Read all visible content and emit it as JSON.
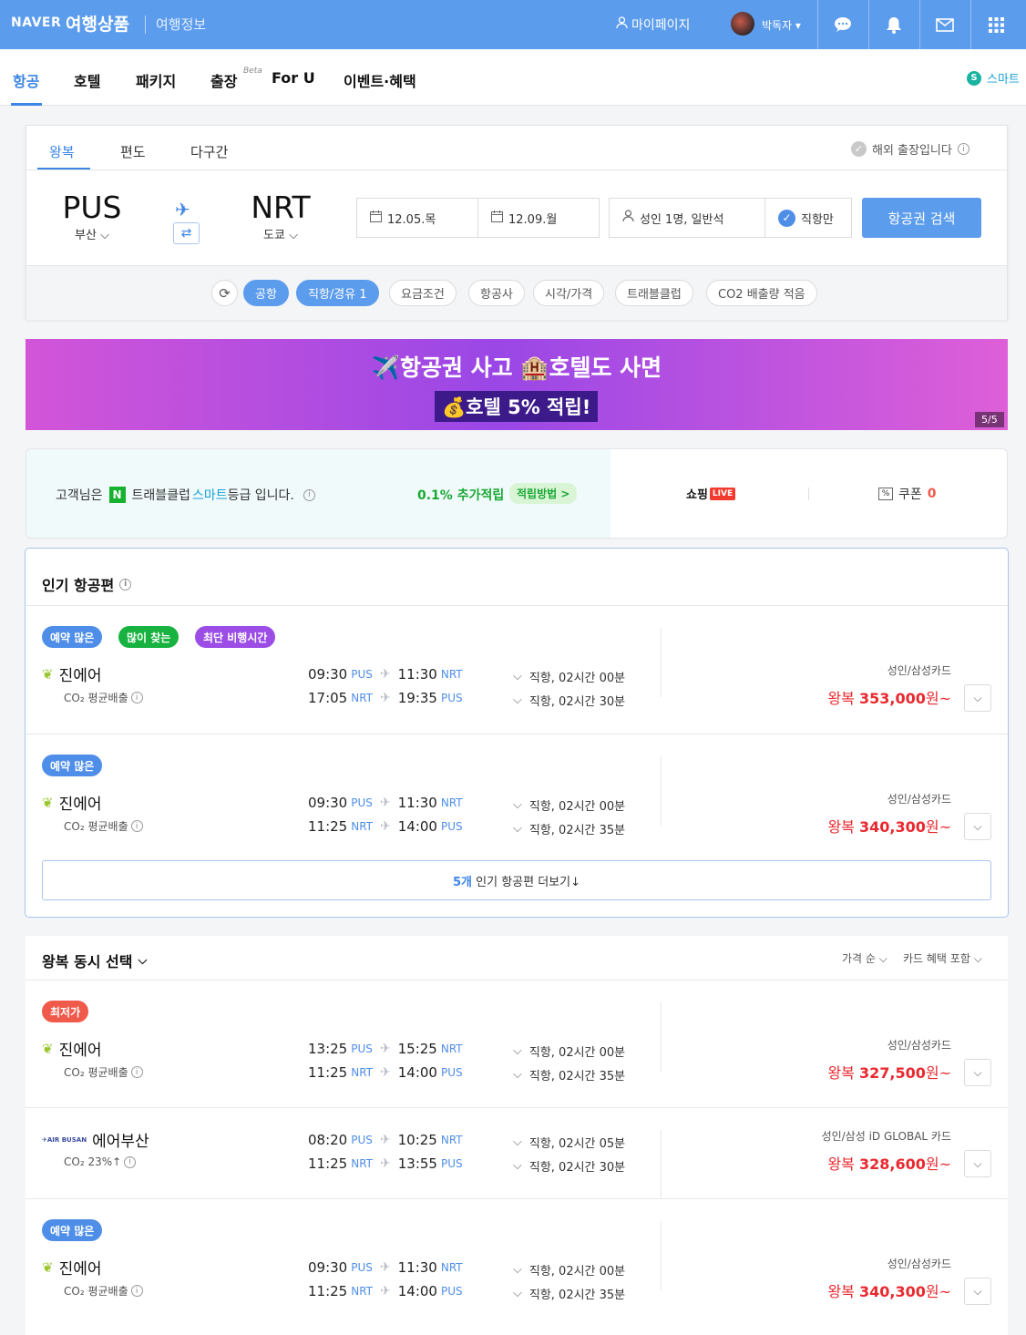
{
  "topbar": {
    "logo": "NAVER",
    "brand": "여행상품",
    "info": "여행정보",
    "mypage": "마이페이지",
    "user": "박독자 ▾",
    "icons": [
      "chat-icon",
      "bell-icon",
      "mail-icon",
      "apps-grid-icon"
    ]
  },
  "nav": {
    "tabs": [
      "항공",
      "호텔",
      "패키지",
      "출장",
      "For U",
      "이벤트·혜택"
    ],
    "beta": "Beta",
    "smart_badge": "S",
    "smart": "스마트"
  },
  "search": {
    "tabs": [
      "왕복",
      "편도",
      "다구간"
    ],
    "overseas": "해외 출장입니다",
    "origin_code": "PUS",
    "origin_city": "부산",
    "dest_code": "NRT",
    "dest_city": "도쿄",
    "date_from": "12.05.목",
    "date_to": "12.09.월",
    "passengers": "성인 1명, 일반석",
    "direct_only": "직항만",
    "search_button": "항공권 검색",
    "filters": [
      "공항",
      "직항/경유 1",
      "요금조건",
      "항공사",
      "시각/가격",
      "트래블클럽",
      "CO2 배출량 적음"
    ]
  },
  "banner": {
    "line1": "✈️항공권 사고 🏨호텔도 사면",
    "line2": "💰호텔 5% 적립!",
    "pager": "5/5"
  },
  "club": {
    "msg_prefix": "고객님은",
    "n_logo": "N",
    "club_name": "트래블클럽",
    "grade": "스마트",
    "msg_suffix": "등급 입니다.",
    "accrue": "0.1% 추가적립",
    "howto": "적립방법 >",
    "shopping": "쇼핑",
    "live": "LIVE",
    "coupon_label": "쿠폰",
    "coupon_count": "0"
  },
  "popular": {
    "title": "인기 항공편",
    "more_count": "5개",
    "more_text": "인기 항공편 더보기↓",
    "flights": [
      {
        "badges": [
          {
            "text": "예약 많은",
            "color": "blue"
          },
          {
            "text": "많이 찾는",
            "color": "green"
          },
          {
            "text": "최단 비행시간",
            "color": "purple"
          }
        ],
        "airline": "진에어",
        "co2": "CO₂ 평균배출",
        "out": {
          "dep": "09:30",
          "dep_ap": "PUS",
          "arr": "11:30",
          "arr_ap": "NRT",
          "dur": "직항, 02시간 00분"
        },
        "ret": {
          "dep": "17:05",
          "dep_ap": "NRT",
          "arr": "19:35",
          "arr_ap": "PUS",
          "dur": "직항, 02시간 30분"
        },
        "card": "성인/삼성카드",
        "price_prefix": "왕복",
        "price": "353,000",
        "price_suffix": "원~"
      },
      {
        "badges": [
          {
            "text": "예약 많은",
            "color": "blue"
          }
        ],
        "airline": "진에어",
        "co2": "CO₂ 평균배출",
        "out": {
          "dep": "09:30",
          "dep_ap": "PUS",
          "arr": "11:30",
          "arr_ap": "NRT",
          "dur": "직항, 02시간 00분"
        },
        "ret": {
          "dep": "11:25",
          "dep_ap": "NRT",
          "arr": "14:00",
          "arr_ap": "PUS",
          "dur": "직항, 02시간 35분"
        },
        "card": "성인/삼성카드",
        "price_prefix": "왕복",
        "price": "340,300",
        "price_suffix": "원~"
      }
    ]
  },
  "roundtrip": {
    "title": "왕복 동시 선택",
    "sort_price": "가격 순",
    "sort_card": "카드 혜택 포함",
    "flights": [
      {
        "badges": [
          {
            "text": "최저가",
            "color": "red"
          }
        ],
        "airline": "진에어",
        "co2": "CO₂ 평균배출",
        "out": {
          "dep": "13:25",
          "dep_ap": "PUS",
          "arr": "15:25",
          "arr_ap": "NRT",
          "dur": "직항, 02시간 00분"
        },
        "ret": {
          "dep": "11:25",
          "dep_ap": "NRT",
          "arr": "14:00",
          "arr_ap": "PUS",
          "dur": "직항, 02시간 35분"
        },
        "card": "성인/삼성카드",
        "price_prefix": "왕복",
        "price": "327,500",
        "price_suffix": "원~"
      },
      {
        "badges": [],
        "airline": "에어부산",
        "co2": "CO₂ 23%↑",
        "out": {
          "dep": "08:20",
          "dep_ap": "PUS",
          "arr": "10:25",
          "arr_ap": "NRT",
          "dur": "직항, 02시간 05분"
        },
        "ret": {
          "dep": "11:25",
          "dep_ap": "NRT",
          "arr": "13:55",
          "arr_ap": "PUS",
          "dur": "직항, 02시간 30분"
        },
        "card": "성인/삼성 iD GLOBAL 카드",
        "price_prefix": "왕복",
        "price": "328,600",
        "price_suffix": "원~"
      },
      {
        "badges": [
          {
            "text": "예약 많은",
            "color": "blue"
          }
        ],
        "airline": "진에어",
        "co2": "CO₂ 평균배출",
        "out": {
          "dep": "09:30",
          "dep_ap": "PUS",
          "arr": "11:30",
          "arr_ap": "NRT",
          "dur": "직항, 02시간 00분"
        },
        "ret": {
          "dep": "11:25",
          "dep_ap": "NRT",
          "arr": "14:00",
          "arr_ap": "PUS",
          "dur": "직항, 02시간 35분"
        },
        "card": "성인/삼성카드",
        "price_prefix": "왕복",
        "price": "340,300",
        "price_suffix": "원~"
      }
    ]
  },
  "colors": {
    "accent": "#5c9cec",
    "price": "#e8292f",
    "green": "#17b23f"
  }
}
